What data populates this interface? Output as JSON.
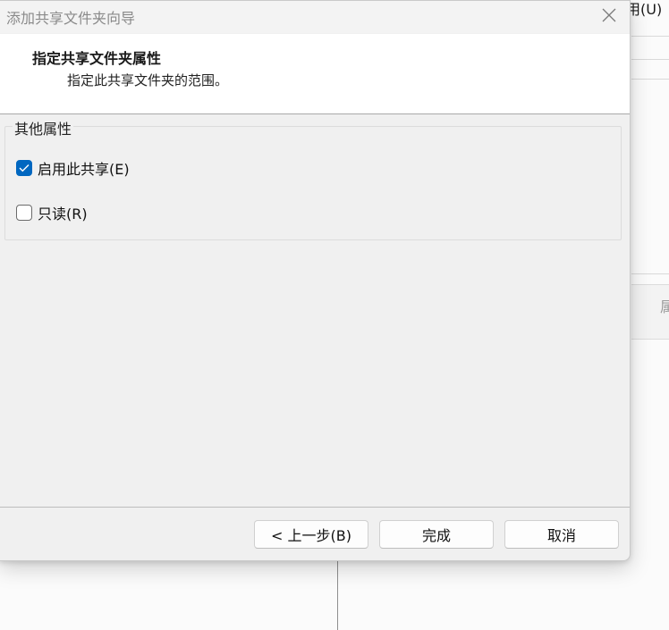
{
  "background": {
    "menu_text": "用(U)",
    "panel_text": "属"
  },
  "dialog": {
    "title": "添加共享文件夹向导",
    "header": {
      "title": "指定共享文件夹属性",
      "subtitle": "指定此共享文件夹的范围。"
    },
    "group": {
      "legend": "其他属性",
      "options": [
        {
          "label": "启用此共享(E)",
          "checked": true
        },
        {
          "label": "只读(R)",
          "checked": false
        }
      ]
    },
    "buttons": {
      "back": "< 上一步(B)",
      "finish": "完成",
      "cancel": "取消"
    },
    "colors": {
      "accent": "#0067c0",
      "dialog_bg": "#f0f0f0"
    }
  }
}
